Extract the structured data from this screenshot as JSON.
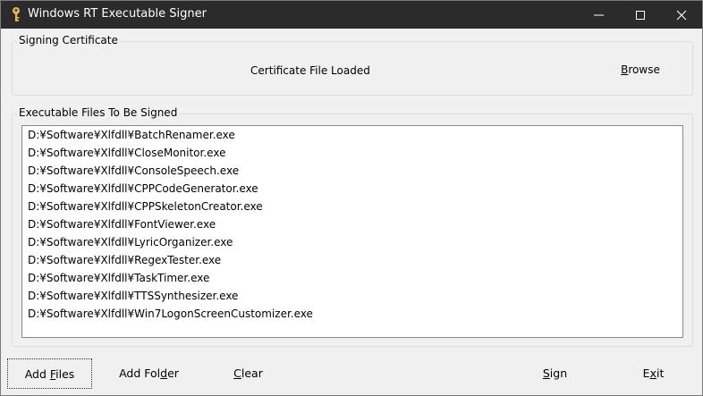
{
  "window": {
    "title": "Windows RT Executable Signer"
  },
  "certificate": {
    "group_label": "Signing Certificate",
    "status": "Certificate File Loaded",
    "browse": {
      "mnemonic": "B",
      "rest": "rowse"
    }
  },
  "files": {
    "group_label": "Executable Files To Be Signed",
    "items": [
      "D:¥Software¥Xlfdll¥BatchRenamer.exe",
      "D:¥Software¥Xlfdll¥CloseMonitor.exe",
      "D:¥Software¥Xlfdll¥ConsoleSpeech.exe",
      "D:¥Software¥Xlfdll¥CPPCodeGenerator.exe",
      "D:¥Software¥Xlfdll¥CPPSkeletonCreator.exe",
      "D:¥Software¥Xlfdll¥FontViewer.exe",
      "D:¥Software¥Xlfdll¥LyricOrganizer.exe",
      "D:¥Software¥Xlfdll¥RegexTester.exe",
      "D:¥Software¥Xlfdll¥TaskTimer.exe",
      "D:¥Software¥Xlfdll¥TTSSynthesizer.exe",
      "D:¥Software¥Xlfdll¥Win7LogonScreenCustomizer.exe"
    ]
  },
  "buttons": {
    "add_files": {
      "pre": "Add ",
      "mnemonic": "F",
      "post": "iles"
    },
    "add_folder": {
      "pre": "Add Fol",
      "mnemonic": "d",
      "post": "er"
    },
    "clear": {
      "pre": "",
      "mnemonic": "C",
      "post": "lear"
    },
    "sign": {
      "pre": "",
      "mnemonic": "S",
      "post": "ign"
    },
    "exit": {
      "pre": "E",
      "mnemonic": "x",
      "post": "it"
    }
  },
  "colors": {
    "titlebar": "#2b2b2b",
    "key_icon": "#e6b84a"
  }
}
